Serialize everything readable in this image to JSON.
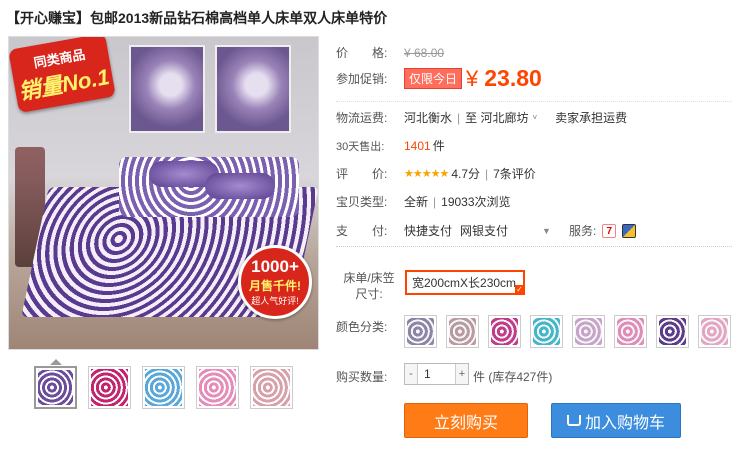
{
  "product": {
    "title": "【开心赚宝】包邮2013新品钻石棉高档单人床单双人床单特价"
  },
  "image": {
    "badge_top_line1": "同类商品",
    "badge_top_line2": "销量No.1",
    "badge_bottom_line1": "1000+",
    "badge_bottom_line2": "月售千件!",
    "badge_bottom_line3": "超人气好评!"
  },
  "thumbnails": [
    {
      "name": "thumb-1",
      "color": "#6a4e9c"
    },
    {
      "name": "thumb-2",
      "color": "#c2256e"
    },
    {
      "name": "thumb-3",
      "color": "#5aa7d9"
    },
    {
      "name": "thumb-4",
      "color": "#e58db8"
    },
    {
      "name": "thumb-5",
      "color": "#d8a0a8"
    }
  ],
  "price": {
    "label": "价　　格:",
    "original": "¥ 68.00"
  },
  "promo": {
    "label": "参加促销:",
    "tag": "仅限今日",
    "currency": "¥",
    "price": "23.80"
  },
  "shipping": {
    "label": "物流运费:",
    "from": "河北衡水",
    "sep": "|",
    "to": "至  河北廊坊",
    "caret": "˅",
    "fee": "卖家承担运费"
  },
  "sales": {
    "label": "30天售出:",
    "count": "1401",
    "unit": "件"
  },
  "rating": {
    "label": "评　　价:",
    "stars": "★★★★★",
    "score": "4.7分",
    "sep": "|",
    "reviews": "7条评价"
  },
  "item_type": {
    "label": "宝贝类型:",
    "type": "全新",
    "sep": "|",
    "views": "19033次浏览"
  },
  "payment": {
    "label": "支　　付:",
    "method1": "快捷支付",
    "method2": "网银支付",
    "scroll_arrow": "▼",
    "service_label": "服务:",
    "service_icon_1": "7"
  },
  "size": {
    "label_line1": "床单/床笠",
    "label_line2": "尺寸:",
    "selected": "宽200cmX长230cm"
  },
  "colors": {
    "label": "颜色分类:",
    "swatches": [
      "#8d84a8",
      "#b89aa0",
      "#c23a8a",
      "#43b6c9",
      "#c7a3cb",
      "#e08bb8",
      "#5a3c8a",
      "#e2a6c4"
    ]
  },
  "quantity": {
    "label": "购买数量:",
    "minus": "-",
    "value": "1",
    "plus": "+",
    "stock": "件 (库存427件)"
  },
  "actions": {
    "buy": "立刻购买",
    "cart": "加入购物车"
  }
}
